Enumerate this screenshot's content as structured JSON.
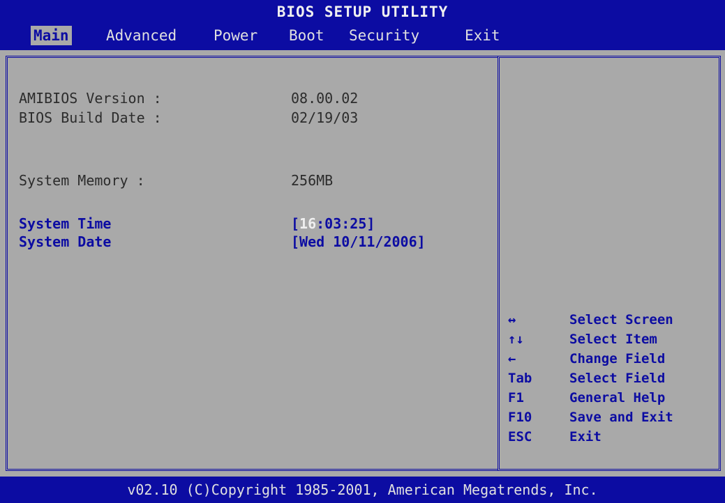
{
  "header": {
    "title": "BIOS SETUP UTILITY",
    "tabs": [
      {
        "label": "Main",
        "active": true
      },
      {
        "label": "Advanced",
        "active": false
      },
      {
        "label": "Power",
        "active": false
      },
      {
        "label": "Boot",
        "active": false
      },
      {
        "label": "Security",
        "active": false
      },
      {
        "label": "Exit",
        "active": false
      }
    ]
  },
  "main": {
    "amibios_version_label": "AMIBIOS Version :",
    "amibios_version_value": "08.00.02",
    "bios_build_date_label": "BIOS Build Date :",
    "bios_build_date_value": "02/19/03",
    "system_memory_label": "System Memory   :",
    "system_memory_value": "256MB",
    "system_time_label": "System Time",
    "system_time_open": "[",
    "system_time_hour": "16",
    "system_time_rest": ":03:25]",
    "system_date_label": "System Date",
    "system_date_value": "[Wed 10/11/2006]"
  },
  "help": {
    "items": [
      {
        "key": "↔",
        "desc": "Select Screen"
      },
      {
        "key": "↑↓",
        "desc": "Select Item"
      },
      {
        "key": "←",
        "desc": "Change Field"
      },
      {
        "key": "Tab",
        "desc": "Select Field"
      },
      {
        "key": "F1",
        "desc": "General Help"
      },
      {
        "key": "F10",
        "desc": "Save and Exit"
      },
      {
        "key": "ESC",
        "desc": "Exit"
      }
    ]
  },
  "footer": {
    "copyright": "v02.10 (C)Copyright 1985-2001, American Megatrends, Inc."
  },
  "colors": {
    "background": "#a9a9a9",
    "bar": "#0c0ca2",
    "highlight": "#f0f0f0"
  }
}
